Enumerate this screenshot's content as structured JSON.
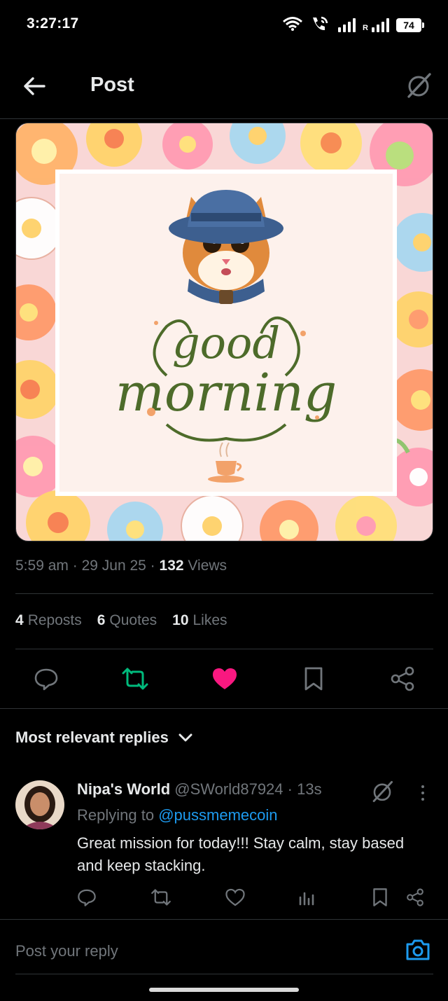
{
  "status_bar": {
    "time": "3:27:17",
    "signal_label": "R",
    "battery": "74"
  },
  "header": {
    "title": "Post",
    "back_icon": "arrow-left-icon",
    "grok_icon": "grok-icon"
  },
  "post": {
    "image": {
      "description_icon": "good-morning-cat-illustration",
      "headline_word1": "good",
      "headline_word2": "morning"
    },
    "time": "5:59 am",
    "date": "29 Jun 25",
    "views_count": "132",
    "views_label": "Views",
    "separator": "·",
    "stats": [
      {
        "count": "4",
        "label": "Reposts"
      },
      {
        "count": "6",
        "label": "Quotes"
      },
      {
        "count": "10",
        "label": "Likes"
      }
    ],
    "actions": [
      "reply-icon",
      "repost-icon",
      "like-icon",
      "bookmark-icon",
      "share-icon"
    ],
    "colors": {
      "repost_active": "#00ba7c",
      "like_active": "#f91880",
      "link": "#1d9bf0"
    }
  },
  "replies": {
    "sort_label": "Most relevant replies",
    "items": [
      {
        "name": "Nipa's World",
        "handle": "@SWorld87924",
        "time": "13s",
        "replying_to_label": "Replying to",
        "replying_to": "@pussmemecoin",
        "text": "Great mission for today!!! Stay calm, stay based and keep stacking."
      }
    ]
  },
  "composer": {
    "placeholder": "Post your reply"
  }
}
